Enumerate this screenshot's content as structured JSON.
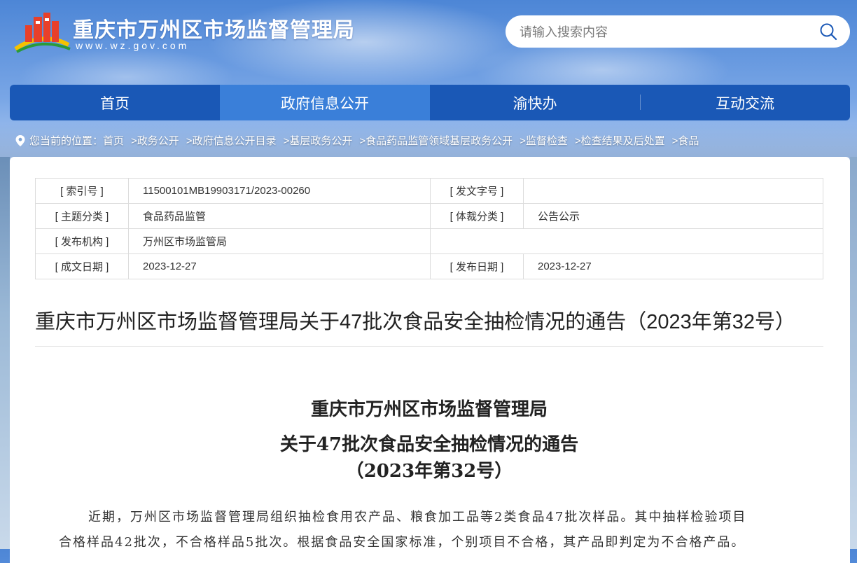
{
  "header": {
    "site_title": "重庆市万州区市场监督管理局",
    "site_url": "www.wz.gov.com",
    "search_placeholder": "请输入搜索内容"
  },
  "nav": {
    "items": [
      {
        "label": "首页"
      },
      {
        "label": "政府信息公开"
      },
      {
        "label": "渝快办"
      },
      {
        "label": "互动交流"
      }
    ],
    "active_index": 1
  },
  "breadcrumb": {
    "prefix": "您当前的位置：",
    "items": [
      "首页",
      ">政务公开",
      ">政府信息公开目录",
      ">基层政务公开",
      ">食品药品监管领域基层政务公开",
      ">监督检查",
      ">检查结果及后处置",
      ">食品"
    ]
  },
  "meta": {
    "index_label": "[ 索引号 ]",
    "index_value": "11500101MB19903171/2023-00260",
    "doc_no_label": "[ 发文字号 ]",
    "doc_no_value": "",
    "topic_label": "[ 主题分类 ]",
    "topic_value": "食品药品监管",
    "genre_label": "[ 体裁分类 ]",
    "genre_value": "公告公示",
    "issuer_label": "[ 发布机构 ]",
    "issuer_value": "万州区市场监管局",
    "written_label": "[ 成文日期 ]",
    "written_value": "2023-12-27",
    "published_label": "[ 发布日期 ]",
    "published_value": "2023-12-27"
  },
  "document": {
    "title": "重庆市万州区市场监督管理局关于47批次食品安全抽检情况的通告（2023年第32号）",
    "body_title_line1": "重庆市万州区市场监督管理局",
    "body_title_line2": "关于47批次食品安全抽检情况的通告",
    "body_title_line3": "（2023年第32号）",
    "paragraph_line1": "近期，万州区市场监督管理局组织抽检食用农产品、粮食加工品等2类食品47批次样品。其中抽样检验项目",
    "paragraph_line2": "合格样品42批次，不合格样品5批次。根据食品安全国家标准，个别项目不合格，其产品即判定为不合格产品。"
  },
  "colors": {
    "nav_bg": "#1a58b6",
    "nav_active": "#3a7fd9"
  }
}
